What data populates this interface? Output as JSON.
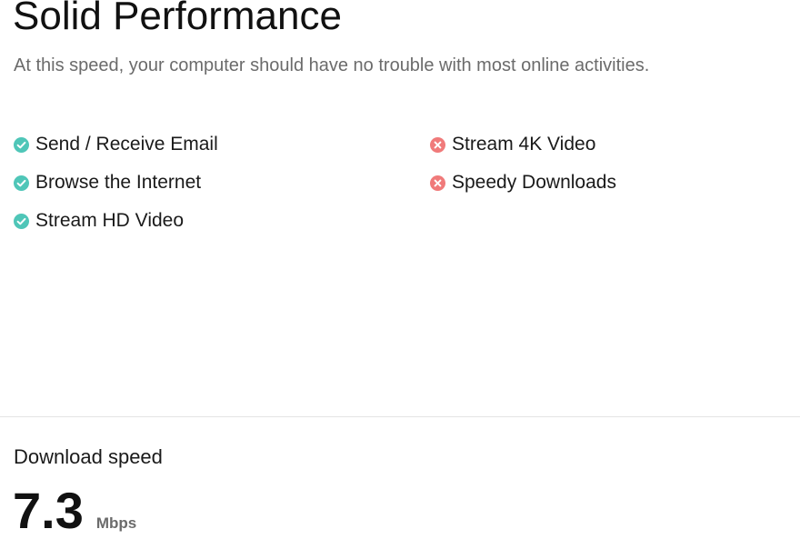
{
  "header": {
    "title": "Solid Performance",
    "subtitle": "At this speed, your computer should have no trouble with most online activities."
  },
  "features": {
    "supported": [
      {
        "label": "Send / Receive Email",
        "icon": "check-circle-icon"
      },
      {
        "label": "Browse the Internet",
        "icon": "check-circle-icon"
      },
      {
        "label": "Stream HD Video",
        "icon": "check-circle-icon"
      }
    ],
    "unsupported": [
      {
        "label": "Stream 4K Video",
        "icon": "x-circle-icon"
      },
      {
        "label": "Speedy Downloads",
        "icon": "x-circle-icon"
      }
    ]
  },
  "result": {
    "label": "Download speed",
    "value": "7.3",
    "unit": "Mbps"
  },
  "colors": {
    "supported": "#4fc6b8",
    "unsupported": "#f07a7a",
    "subtitle": "#6b6b6b",
    "divider": "#e4e4e4"
  }
}
